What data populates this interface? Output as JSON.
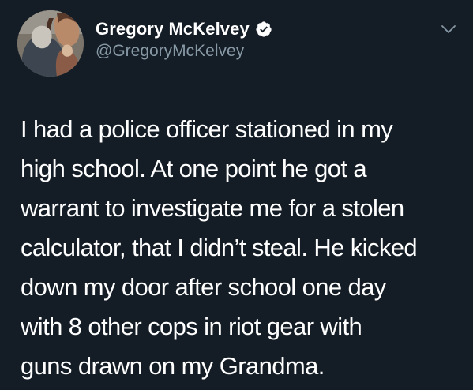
{
  "tweet": {
    "author": {
      "display_name": "Gregory McKelvey",
      "handle": "@GregoryMcKelvey",
      "verified": true
    },
    "text": "I had a police officer stationed in my\nhigh school. At one point he got a\nwarrant to investigate me for a stolen\ncalculator, that I didn’t steal. He kicked\ndown my door after school one day\nwith 8 other cops in riot gear with\nguns drawn on my Grandma."
  },
  "icons": {
    "verified": "verified-badge-icon",
    "menu": "chevron-down-icon"
  },
  "colors": {
    "background": "#141d26",
    "text": "#ffffff",
    "secondary_text": "#8899a6",
    "verified_badge": "#ffffff"
  }
}
